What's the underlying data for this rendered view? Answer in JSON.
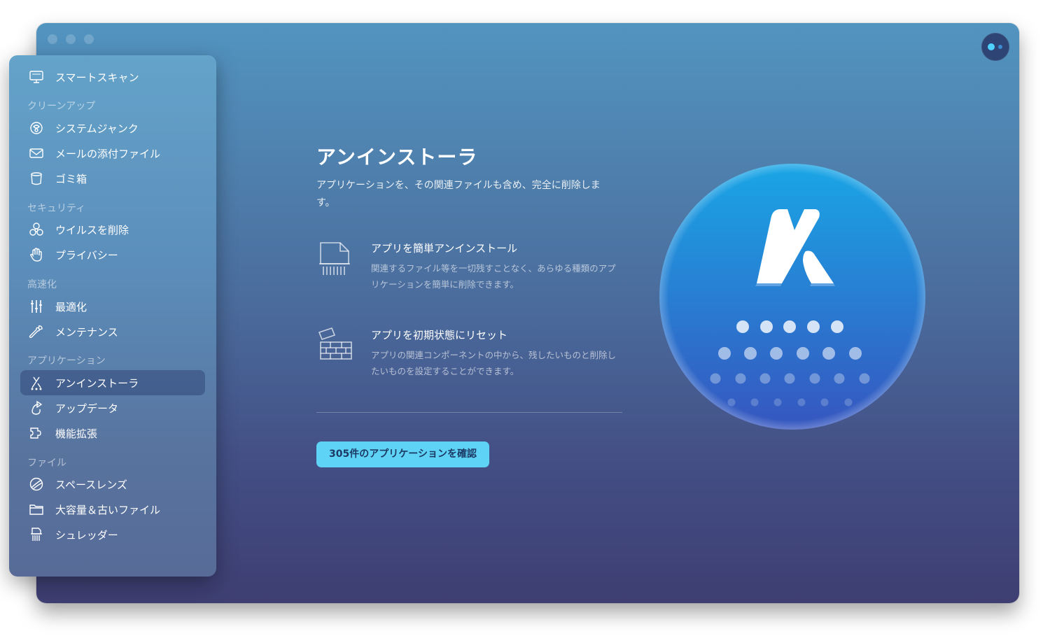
{
  "window": {
    "traffic_lights": [
      "close",
      "minimize",
      "zoom"
    ],
    "assistant_icon": "assistant-dots-icon"
  },
  "sidebar": {
    "top_item": {
      "label": "スマートスキャン",
      "icon": "monitor-scan-icon"
    },
    "sections": [
      {
        "title": "クリーンアップ",
        "items": [
          {
            "label": "システムジャンク",
            "icon": "system-junk-icon"
          },
          {
            "label": "メールの添付ファイル",
            "icon": "envelope-icon"
          },
          {
            "label": "ゴミ箱",
            "icon": "trash-bin-icon"
          }
        ]
      },
      {
        "title": "セキュリティ",
        "items": [
          {
            "label": "ウイルスを削除",
            "icon": "biohazard-icon"
          },
          {
            "label": "プライバシー",
            "icon": "hand-icon"
          }
        ]
      },
      {
        "title": "高速化",
        "items": [
          {
            "label": "最適化",
            "icon": "sliders-icon"
          },
          {
            "label": "メンテナンス",
            "icon": "wrench-icon"
          }
        ]
      },
      {
        "title": "アプリケーション",
        "items": [
          {
            "label": "アンインストーラ",
            "icon": "uninstaller-icon",
            "active": true
          },
          {
            "label": "アップデータ",
            "icon": "updater-icon"
          },
          {
            "label": "機能拡張",
            "icon": "extensions-icon"
          }
        ]
      },
      {
        "title": "ファイル",
        "items": [
          {
            "label": "スペースレンズ",
            "icon": "space-lens-icon"
          },
          {
            "label": "大容量＆古いファイル",
            "icon": "folder-icon"
          },
          {
            "label": "シュレッダー",
            "icon": "shredder-icon"
          }
        ]
      }
    ]
  },
  "main": {
    "title": "アンインストーラ",
    "description": "アプリケーションを、その関連ファイルも含め、完全に削除します。",
    "features": [
      {
        "title": "アプリを簡単アンインストール",
        "description": "関連するファイル等を一切残すことなく、あらゆる種類のアプリケーションを簡単に削除できます。",
        "icon": "document-shred-icon"
      },
      {
        "title": "アプリを初期状態にリセット",
        "description": "アプリの関連コンポーネントの中から、残したいものと削除したいものを設定することができます。",
        "icon": "brick-wall-icon"
      }
    ],
    "cta_label": "305件のアプリケーションを確認",
    "hero_icon": "uninstaller-hero-icon"
  },
  "colors": {
    "cta_background": "#5fd3f5",
    "cta_text": "#1c3a66",
    "hero_top": "#1aa6e6",
    "hero_bottom": "#3656bf"
  }
}
